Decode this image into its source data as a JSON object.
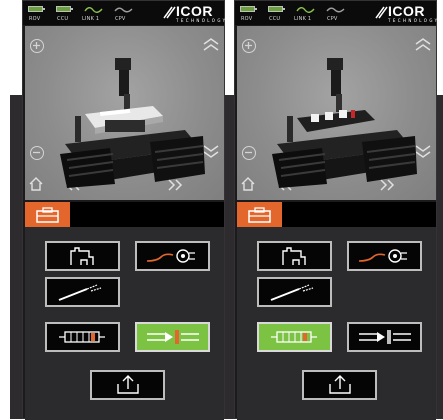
{
  "status_labels": [
    "ROV",
    "CCU",
    "LINK 1",
    "CPV"
  ],
  "logo": {
    "name": "ICOR",
    "sub": "TECHNOLOGY"
  },
  "colors": {
    "accent_orange": "#e3672c",
    "active_green": "#7cc344",
    "battery_green": "#6aa13a"
  },
  "panels": [
    {
      "id": "left",
      "active_button": "cable-tool-button"
    },
    {
      "id": "right",
      "active_button": "disruptor-button"
    }
  ],
  "icons": {
    "zoom_in": "plus-circle-icon",
    "zoom_out": "minus-circle-icon",
    "home": "home-icon",
    "toolbox": "toolbox-icon"
  }
}
